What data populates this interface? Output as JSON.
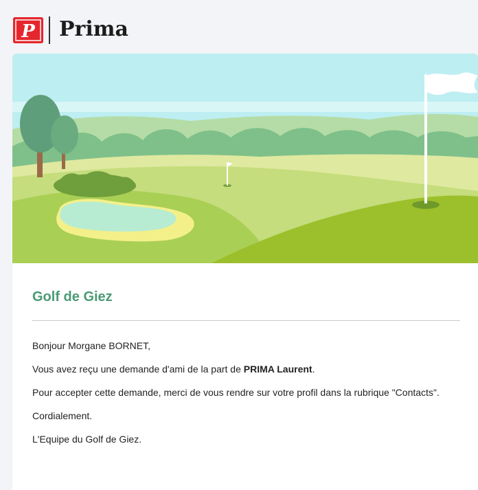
{
  "header": {
    "logo_letter": "P",
    "brand_name": "Prima"
  },
  "email": {
    "title": "Golf de Giez",
    "greeting": "Bonjour Morgane BORNET,",
    "request_prefix": "Vous avez reçu une demande d'ami de la part de ",
    "request_sender": "PRIMA Laurent",
    "request_suffix": ".",
    "instructions": "Pour accepter cette demande, merci de vous rendre sur votre profil dans la rubrique \"Contacts\".",
    "closing": "Cordialement.",
    "signature": "L'Equipe du Golf de Giez."
  },
  "colors": {
    "brand_red": "#e5262d",
    "title_green": "#4b9a74",
    "sky": "#bdeef2",
    "grass_dark": "#8fbd3a",
    "grass_light": "#d6e69a"
  },
  "icons": {
    "logo": "prima-p-logo",
    "hero": "golf-course-illustration"
  }
}
